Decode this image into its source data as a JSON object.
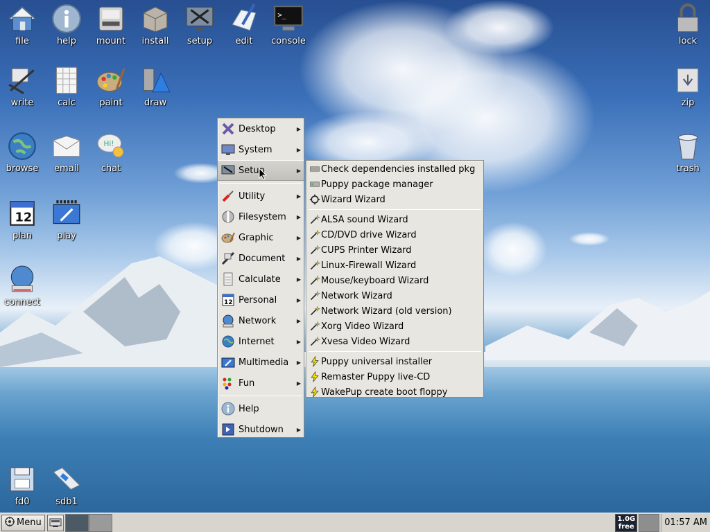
{
  "desktop_icons": [
    {
      "label": "file",
      "icon": "home-folder-icon"
    },
    {
      "label": "help",
      "icon": "info-icon"
    },
    {
      "label": "mount",
      "icon": "drive-icon"
    },
    {
      "label": "install",
      "icon": "package-box-icon"
    },
    {
      "label": "setup",
      "icon": "tools-monitor-icon"
    },
    {
      "label": "edit",
      "icon": "notepad-pen-icon"
    },
    {
      "label": "console",
      "icon": "terminal-icon"
    },
    {
      "label": "write",
      "icon": "typewriter-icon"
    },
    {
      "label": "calc",
      "icon": "spreadsheet-icon"
    },
    {
      "label": "paint",
      "icon": "palette-icon"
    },
    {
      "label": "draw",
      "icon": "draw-shapes-icon"
    },
    {
      "label": "browse",
      "icon": "globe-icon"
    },
    {
      "label": "email",
      "icon": "envelope-icon"
    },
    {
      "label": "chat",
      "icon": "chat-bubble-icon"
    },
    {
      "label": "plan",
      "icon": "calendar-icon"
    },
    {
      "label": "play",
      "icon": "film-icon"
    },
    {
      "label": "connect",
      "icon": "network-globe-icon"
    },
    {
      "label": "lock",
      "icon": "padlock-icon"
    },
    {
      "label": "zip",
      "icon": "archive-icon"
    },
    {
      "label": "trash",
      "icon": "trash-can-icon"
    },
    {
      "label": "fd0",
      "icon": "floppy-icon"
    },
    {
      "label": "sdb1",
      "icon": "usb-drive-icon"
    }
  ],
  "main_menu": {
    "items": [
      {
        "label": "Desktop",
        "icon": "x-logo-icon",
        "has_submenu": true
      },
      {
        "label": "System",
        "icon": "monitor-icon",
        "has_submenu": true
      },
      {
        "label": "Setup",
        "icon": "setup-monitor-icon",
        "has_submenu": true,
        "active": true
      },
      {
        "label": "Utility",
        "icon": "screwdriver-icon",
        "has_submenu": true
      },
      {
        "label": "Filesystem",
        "icon": "filesystem-icon",
        "has_submenu": true
      },
      {
        "label": "Graphic",
        "icon": "palette-icon",
        "has_submenu": true
      },
      {
        "label": "Document",
        "icon": "document-icon",
        "has_submenu": true
      },
      {
        "label": "Calculate",
        "icon": "calculator-icon",
        "has_submenu": true
      },
      {
        "label": "Personal",
        "icon": "calendar-icon",
        "has_submenu": true
      },
      {
        "label": "Network",
        "icon": "network-icon",
        "has_submenu": true
      },
      {
        "label": "Internet",
        "icon": "globe-icon",
        "has_submenu": true
      },
      {
        "label": "Multimedia",
        "icon": "multimedia-icon",
        "has_submenu": true
      },
      {
        "label": "Fun",
        "icon": "fun-dots-icon",
        "has_submenu": true
      },
      {
        "label": "Help",
        "icon": "info-icon",
        "has_submenu": false
      },
      {
        "label": "Shutdown",
        "icon": "shutdown-icon",
        "has_submenu": true
      }
    ]
  },
  "setup_submenu": {
    "groups": [
      [
        {
          "label": "Check dependencies installed pkg",
          "icon": "package-check-icon"
        },
        {
          "label": "Puppy package manager",
          "icon": "package-manager-icon"
        },
        {
          "label": "Wizard Wizard",
          "icon": "wizard-gear-icon"
        }
      ],
      [
        {
          "label": "ALSA sound Wizard",
          "icon": "wand-icon"
        },
        {
          "label": "CD/DVD drive Wizard",
          "icon": "wand-icon"
        },
        {
          "label": "CUPS Printer Wizard",
          "icon": "wand-icon"
        },
        {
          "label": "Linux-Firewall Wizard",
          "icon": "wand-icon"
        },
        {
          "label": "Mouse/keyboard Wizard",
          "icon": "wand-icon"
        },
        {
          "label": "Network Wizard",
          "icon": "wand-icon"
        },
        {
          "label": "Network Wizard (old version)",
          "icon": "wand-icon"
        },
        {
          "label": "Xorg Video Wizard",
          "icon": "wand-icon"
        },
        {
          "label": "Xvesa Video Wizard",
          "icon": "wand-icon"
        }
      ],
      [
        {
          "label": "Puppy universal installer",
          "icon": "lightning-icon"
        },
        {
          "label": "Remaster Puppy live-CD",
          "icon": "lightning-icon"
        },
        {
          "label": "WakePup create boot floppy",
          "icon": "lightning-icon"
        }
      ]
    ]
  },
  "taskbar": {
    "menu_label": "Menu",
    "free_space_top": "1.0G",
    "free_space_bottom": "free",
    "clock": "01:57 AM"
  }
}
